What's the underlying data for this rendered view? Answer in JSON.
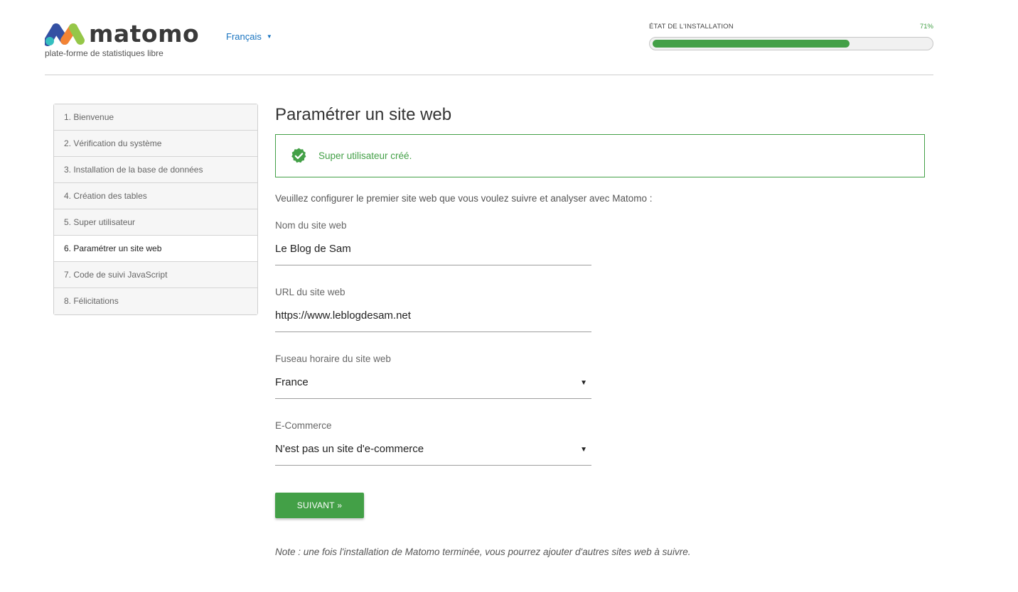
{
  "brand": {
    "name": "matomo",
    "tagline": "plate-forme de statistiques libre",
    "colors": {
      "blue": "#3450a3",
      "green": "#95c748",
      "orange": "#f38334",
      "teal": "#35bfc0"
    }
  },
  "language": {
    "selected": "Français"
  },
  "install_progress": {
    "label": "ÉTAT DE L'INSTALLATION",
    "percent_text": "71%",
    "percent": 71
  },
  "steps": [
    {
      "label": "1. Bienvenue"
    },
    {
      "label": "2. Vérification du système"
    },
    {
      "label": "3. Installation de la base de données"
    },
    {
      "label": "4. Création des tables"
    },
    {
      "label": "5. Super utilisateur"
    },
    {
      "label": "6. Paramétrer un site web",
      "active": true
    },
    {
      "label": "7. Code de suivi JavaScript"
    },
    {
      "label": "8. Félicitations"
    }
  ],
  "main": {
    "title": "Paramétrer un site web",
    "notification": {
      "icon": "check-badge-icon",
      "message": "Super utilisateur créé."
    },
    "intro": "Veuillez configurer le premier site web que vous voulez suivre et analyser avec Matomo :",
    "fields": {
      "site_name": {
        "label": "Nom du site web",
        "value": "Le Blog de Sam"
      },
      "site_url": {
        "label": "URL du site web",
        "value": "https://www.leblogdesam.net"
      },
      "timezone": {
        "label": "Fuseau horaire du site web",
        "value": "France"
      },
      "ecommerce": {
        "label": "E-Commerce",
        "value": "N'est pas un site d'e-commerce"
      }
    },
    "next_button": "SUIVANT »",
    "note": "Note : une fois l'installation de Matomo terminée, vous pourrez ajouter d'autres sites web à suivre."
  },
  "accent_color": "#43a047"
}
